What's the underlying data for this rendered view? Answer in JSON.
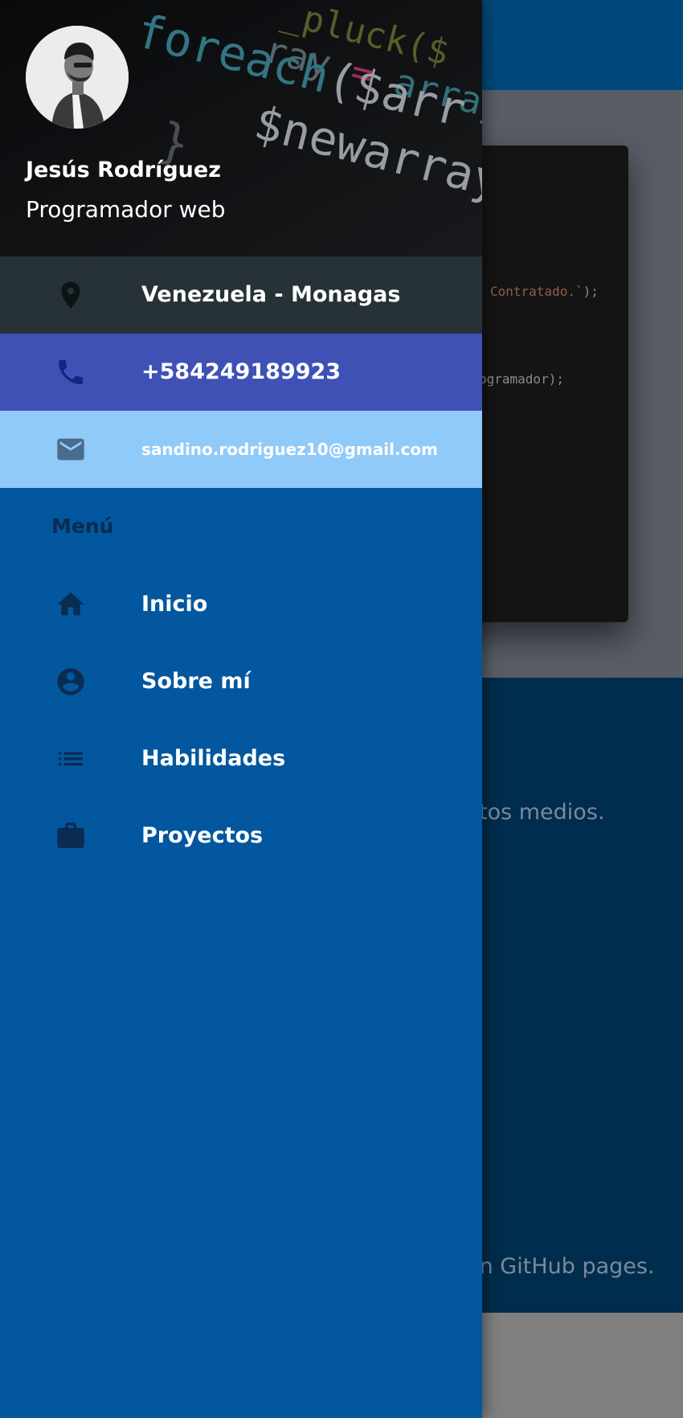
{
  "background": {
    "code_lines": [
      {
        "code": "",
        "string": "Contratado.`",
        "suffix": ");"
      },
      {
        "code": "ogramador);",
        "string": "",
        "suffix": ""
      }
    ],
    "section_texts": [
      "tos medios.",
      "en GitHub pages."
    ]
  },
  "drawer": {
    "profile": {
      "name": "Jesús Rodríguez",
      "role": "Programador web",
      "avatar_icon": "profile-photo"
    },
    "header_code": [
      "ray = array",
      "foreach($arr as",
      "$newarray["
    ],
    "contacts": [
      {
        "icon": "location-pin-icon",
        "label": "Venezuela - Monagas",
        "color": "#263238"
      },
      {
        "icon": "phone-icon",
        "label": "+584249189923",
        "color": "#3f51b5"
      },
      {
        "icon": "email-icon",
        "label": "sandino.rodriguez10@gmail.com",
        "color": "#90caf9"
      }
    ],
    "menu_heading": "Menú",
    "menu_items": [
      {
        "icon": "home-icon",
        "label": "Inicio"
      },
      {
        "icon": "account-circle-icon",
        "label": "Sobre mí"
      },
      {
        "icon": "list-icon",
        "label": "Habilidades"
      },
      {
        "icon": "briefcase-icon",
        "label": "Proyectos"
      }
    ]
  }
}
